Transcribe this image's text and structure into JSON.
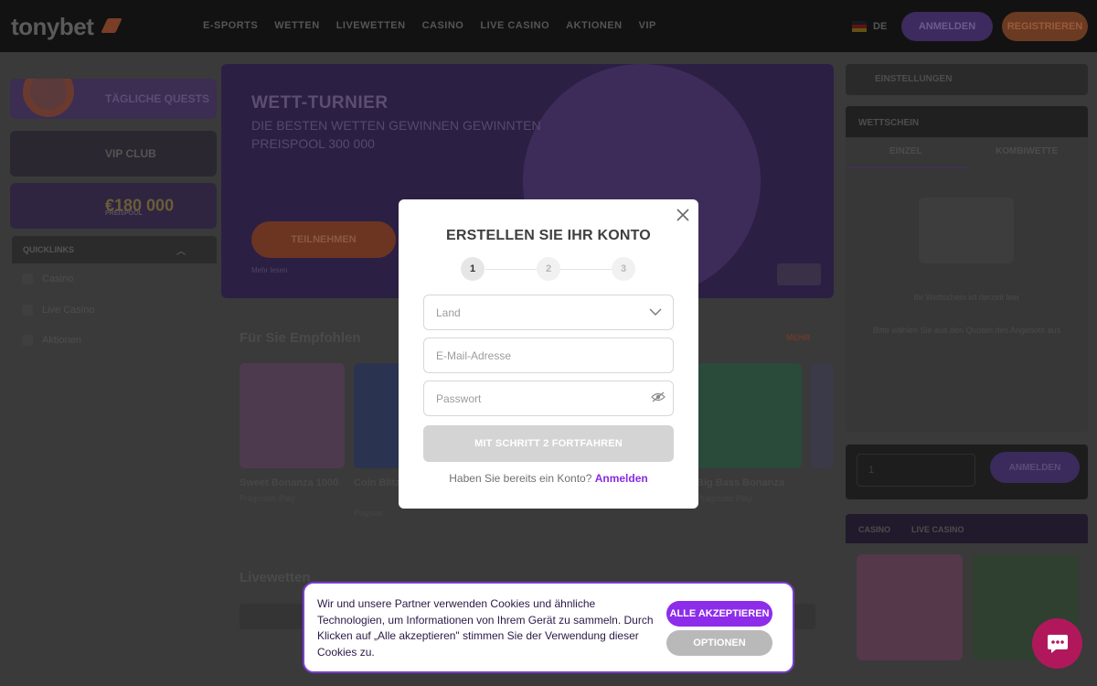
{
  "header": {
    "logo": "tonybet",
    "nav": [
      "E-SPORTS",
      "WETTEN",
      "LIVEWETTEN",
      "CASINO",
      "LIVE CASINO",
      "AKTIONEN",
      "VIP"
    ],
    "language": "DE",
    "login_label": "ANMELDEN",
    "register_label": "REGISTRIEREN",
    "flag_colors": [
      "#1a1a1a",
      "#5c1414",
      "#5f5214"
    ]
  },
  "sidebar": {
    "banners": [
      "TÄGLICHE QUESTS",
      "VIP CLUB",
      "€180 000"
    ],
    "banner_sub": "PREISPOOL",
    "quicklinks_title": "QUICKLINKS",
    "links": [
      "Casino",
      "Live Casino",
      "Aktionen"
    ]
  },
  "hero": {
    "title": "WETT-TURNIER",
    "subtitle": "DIE BESTEN WETTEN GEWINNEN GEWINNTEN PREISPOOL 300 000",
    "cta": "TEILNEHMEN",
    "small": "Mehr lesen"
  },
  "recommended": {
    "title": "Für Sie Empfohlen",
    "more": "MEHR",
    "games": [
      {
        "name": "Sweet Bonanza 1000",
        "provider": "Pragmatic Play"
      },
      {
        "name": "Coin Blitz ULTIMATE",
        "provider": "Playson"
      },
      {
        "name": "",
        "provider": ""
      },
      {
        "name": "",
        "provider": ""
      },
      {
        "name": "Big Bass Bonanza",
        "provider": "Pragmatic Play"
      }
    ]
  },
  "live": {
    "title": "Livewetten"
  },
  "right": {
    "settings": "EINSTELLUNGEN",
    "betslip_title": "WETTSCHEIN",
    "tabs": [
      "EINZEL",
      "KOMBIWETTE"
    ],
    "empty_title": "Ihr Wettschein ist derzeit leer",
    "empty_text": "Bitte wählen Sie aus den Quoten des Angebots aus",
    "place_label": "ANMELDEN",
    "stake_value": "1",
    "casino_tabs": [
      "CASINO",
      "LIVE CASINO"
    ]
  },
  "modal": {
    "title": "ERSTELLEN SIE IHR KONTO",
    "steps": [
      "1",
      "2",
      "3"
    ],
    "country_placeholder": "Land",
    "email_placeholder": "E-Mail-Adresse",
    "password_placeholder": "Passwort",
    "continue_label": "MIT SCHRITT 2 FORTFAHREN",
    "have_account": "Haben Sie bereits ein Konto?",
    "login_link": "Anmelden"
  },
  "cookie": {
    "text": "Wir und unsere Partner verwenden Cookies und ähnliche Technologien, um Informationen von Ihrem Gerät zu sammeln. Durch Klicken auf „Alle akzeptieren\" stimmen Sie der Verwendung dieser Cookies zu.",
    "accept_label": "ALLE AKZEPTIEREN",
    "options_label": "OPTIONEN"
  },
  "colors": {
    "accent": "#8d2dea",
    "chat": "#b1185c",
    "overlay_bg": "#3a3a3a"
  }
}
